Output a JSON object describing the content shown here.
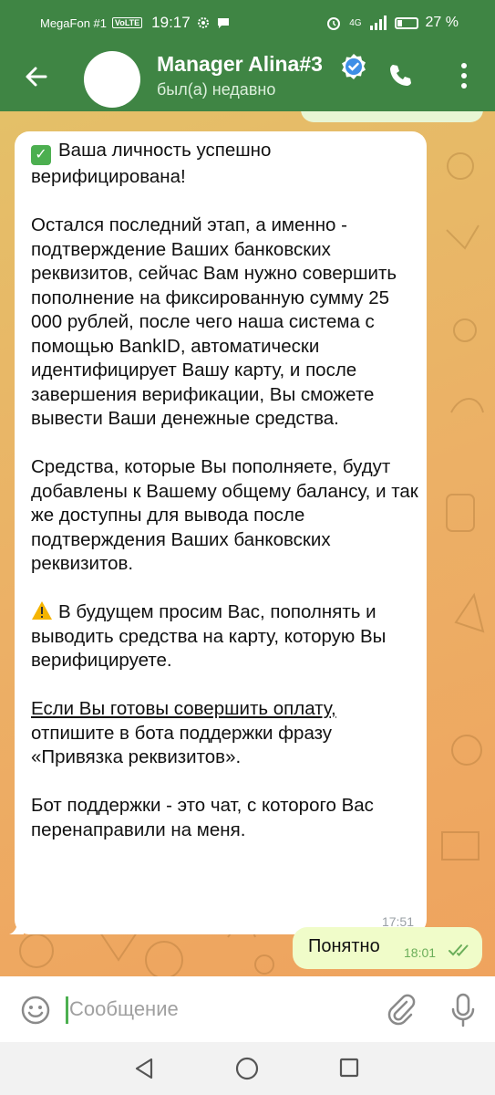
{
  "status_bar": {
    "carrier": "MegaFon #1",
    "volte": "VoLTE",
    "time": "19:17",
    "network": "4G",
    "battery": "27 %"
  },
  "header": {
    "contact_name": "Manager Alina#3",
    "last_seen": "был(а) недавно"
  },
  "incoming_message": {
    "paragraphs": [
      "Ваша личность успешно верифицирована!",
      "Остался последний этап, а именно - подтверждение Ваших банковских реквизитов, сейчас Вам нужно совершить пополнение на фиксированную сумму 25 000 рублей, после чего наша система с помощью BankID, автоматически идентифицирует Вашу карту, и после завершения верификации, Вы сможете вывести Ваши денежные средства.",
      "Средства, которые Вы пополняете, будут добавлены к Вашему общему балансу, и так же доступны для вывода после подтверждения Ваших банковских реквизитов.",
      "В будущем просим Вас, пополнять и выводить средства на карту, которую Вы верифицируете.",
      "Если Вы готовы совершить оплату,",
      "отпишите в бота поддержки фразу «Привязка реквизитов».",
      "Бот поддержки - это чат, с которого Вас перенаправили на меня."
    ],
    "time": "17:51"
  },
  "outgoing_message": {
    "text": "Понятно",
    "time": "18:01"
  },
  "input": {
    "placeholder": "Сообщение"
  },
  "colors": {
    "header_bg": "#3f8544",
    "outgoing_bubble": "#f0fcc9",
    "incoming_bubble": "#ffffff",
    "accent_green": "#4caf50"
  }
}
